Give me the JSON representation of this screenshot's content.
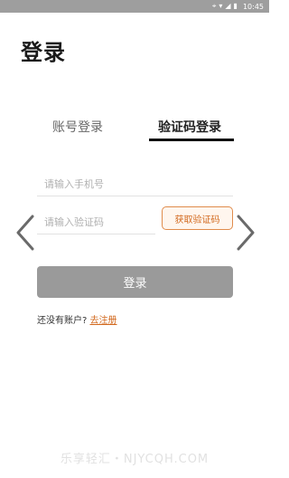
{
  "status_bar": {
    "time": "10:45"
  },
  "page": {
    "title": "登录"
  },
  "tabs": [
    {
      "label": "账号登录",
      "active": false
    },
    {
      "label": "验证码登录",
      "active": true
    }
  ],
  "form": {
    "phone_placeholder": "请输入手机号",
    "code_placeholder": "请输入验证码",
    "get_code_label": "获取验证码",
    "login_label": "登录"
  },
  "register": {
    "prompt": "还没有账户?",
    "link_label": "去注册"
  },
  "watermark": "乐享轻汇・NJYCQH.COM",
  "colors": {
    "accent": "#d2691e",
    "login_button": "#9a9a9a",
    "status_bar": "#9e9e9e"
  }
}
